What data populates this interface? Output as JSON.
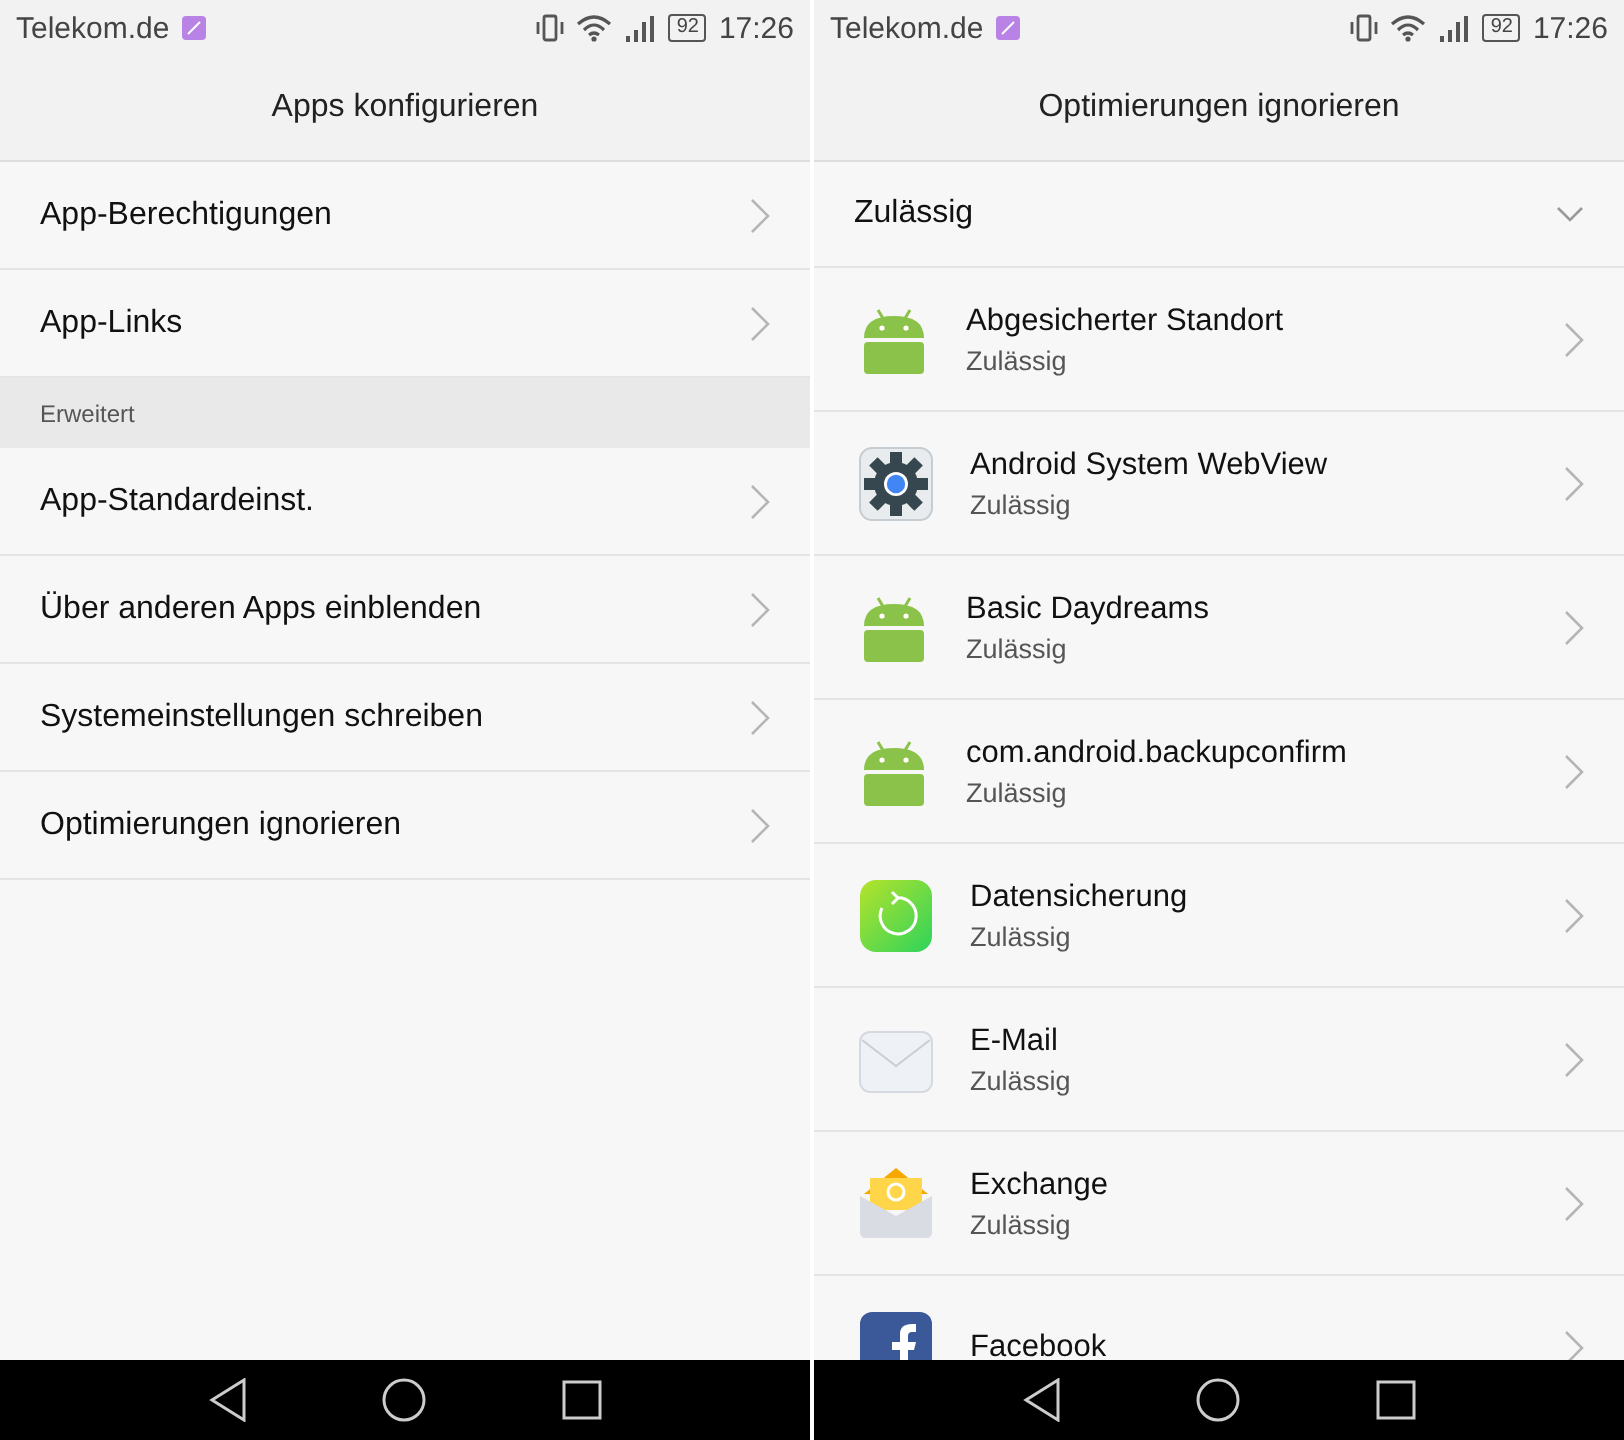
{
  "screens": [
    {
      "status_bar": {
        "carrier": "Telekom.de",
        "battery": "92",
        "time": "17:26"
      },
      "title": "Apps konfigurieren",
      "items": [
        {
          "kind": "item",
          "label": "App-Berechtigungen"
        },
        {
          "kind": "item",
          "label": "App-Links"
        },
        {
          "kind": "section",
          "label": "Erweitert"
        },
        {
          "kind": "item",
          "label": "App-Standardeinst."
        },
        {
          "kind": "item",
          "label": "Über anderen Apps einblenden"
        },
        {
          "kind": "item",
          "label": "Systemeinstellungen schreiben"
        },
        {
          "kind": "item",
          "label": "Optimierungen ignorieren"
        }
      ]
    },
    {
      "status_bar": {
        "carrier": "Telekom.de",
        "battery": "92",
        "time": "17:26"
      },
      "title": "Optimierungen ignorieren",
      "filter": "Zulässig",
      "apps": [
        {
          "kind": "android",
          "name": "Abgesicherter Standort",
          "status": "Zulässig"
        },
        {
          "kind": "webview",
          "name": "Android System WebView",
          "status": "Zulässig"
        },
        {
          "kind": "android",
          "name": "Basic Daydreams",
          "status": "Zulässig"
        },
        {
          "kind": "android",
          "name": "com.android.backupconfirm",
          "status": "Zulässig"
        },
        {
          "kind": "backup",
          "name": "Datensicherung",
          "status": "Zulässig"
        },
        {
          "kind": "email",
          "name": "E-Mail",
          "status": "Zulässig"
        },
        {
          "kind": "exchange",
          "name": "Exchange",
          "status": "Zulässig"
        },
        {
          "kind": "facebook",
          "name": "Facebook"
        }
      ]
    }
  ]
}
